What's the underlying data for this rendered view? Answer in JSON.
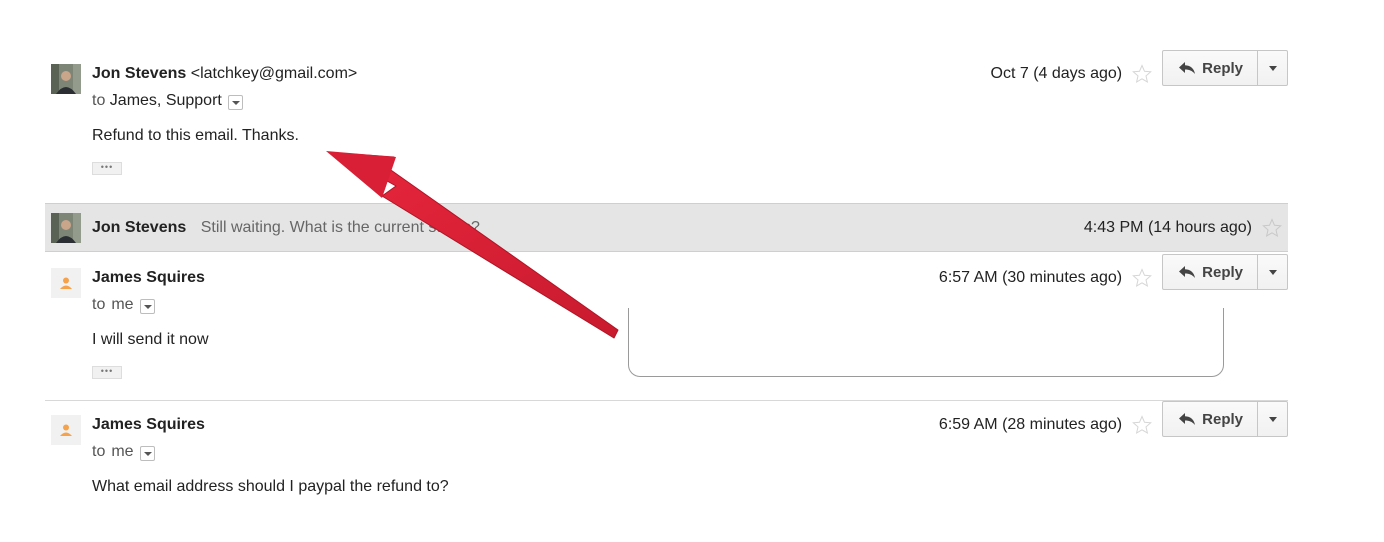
{
  "messages": [
    {
      "sender_name": "Jon Stevens",
      "sender_email": "<latchkey@gmail.com>",
      "to_prefix": "to",
      "to_names": "James, Support",
      "date": "Oct 7 (4 days ago)",
      "body": "Refund to this email. Thanks.",
      "trimmed_label": "•••",
      "avatar": "user-photo",
      "reply_label": "Reply"
    },
    {
      "sender_name": "Jon Stevens",
      "snippet": "Still waiting. What is the current status?",
      "date": "4:43 PM (14 hours ago)",
      "avatar": "user-photo"
    },
    {
      "sender_name": "James Squires",
      "to_prefix": "to",
      "to_names": "me",
      "date": "6:57 AM (30 minutes ago)",
      "body": "I will send it now",
      "trimmed_label": "•••",
      "avatar": "default-user-icon",
      "reply_label": "Reply"
    },
    {
      "sender_name": "James Squires",
      "to_prefix": "to",
      "to_names": "me",
      "date": "6:59 AM (28 minutes ago)",
      "body": "What email address should I paypal the refund to?",
      "avatar": "default-user-icon",
      "reply_label": "Reply"
    }
  ],
  "colors": {
    "annotation_arrow": "#d81f35",
    "collapsed_bg": "#e5e5e5",
    "default_avatar": "#f5a24a"
  },
  "icons": [
    "reply-arrow-icon",
    "star-icon",
    "dropdown-caret-icon",
    "show-details-icon",
    "annotation-arrow"
  ]
}
